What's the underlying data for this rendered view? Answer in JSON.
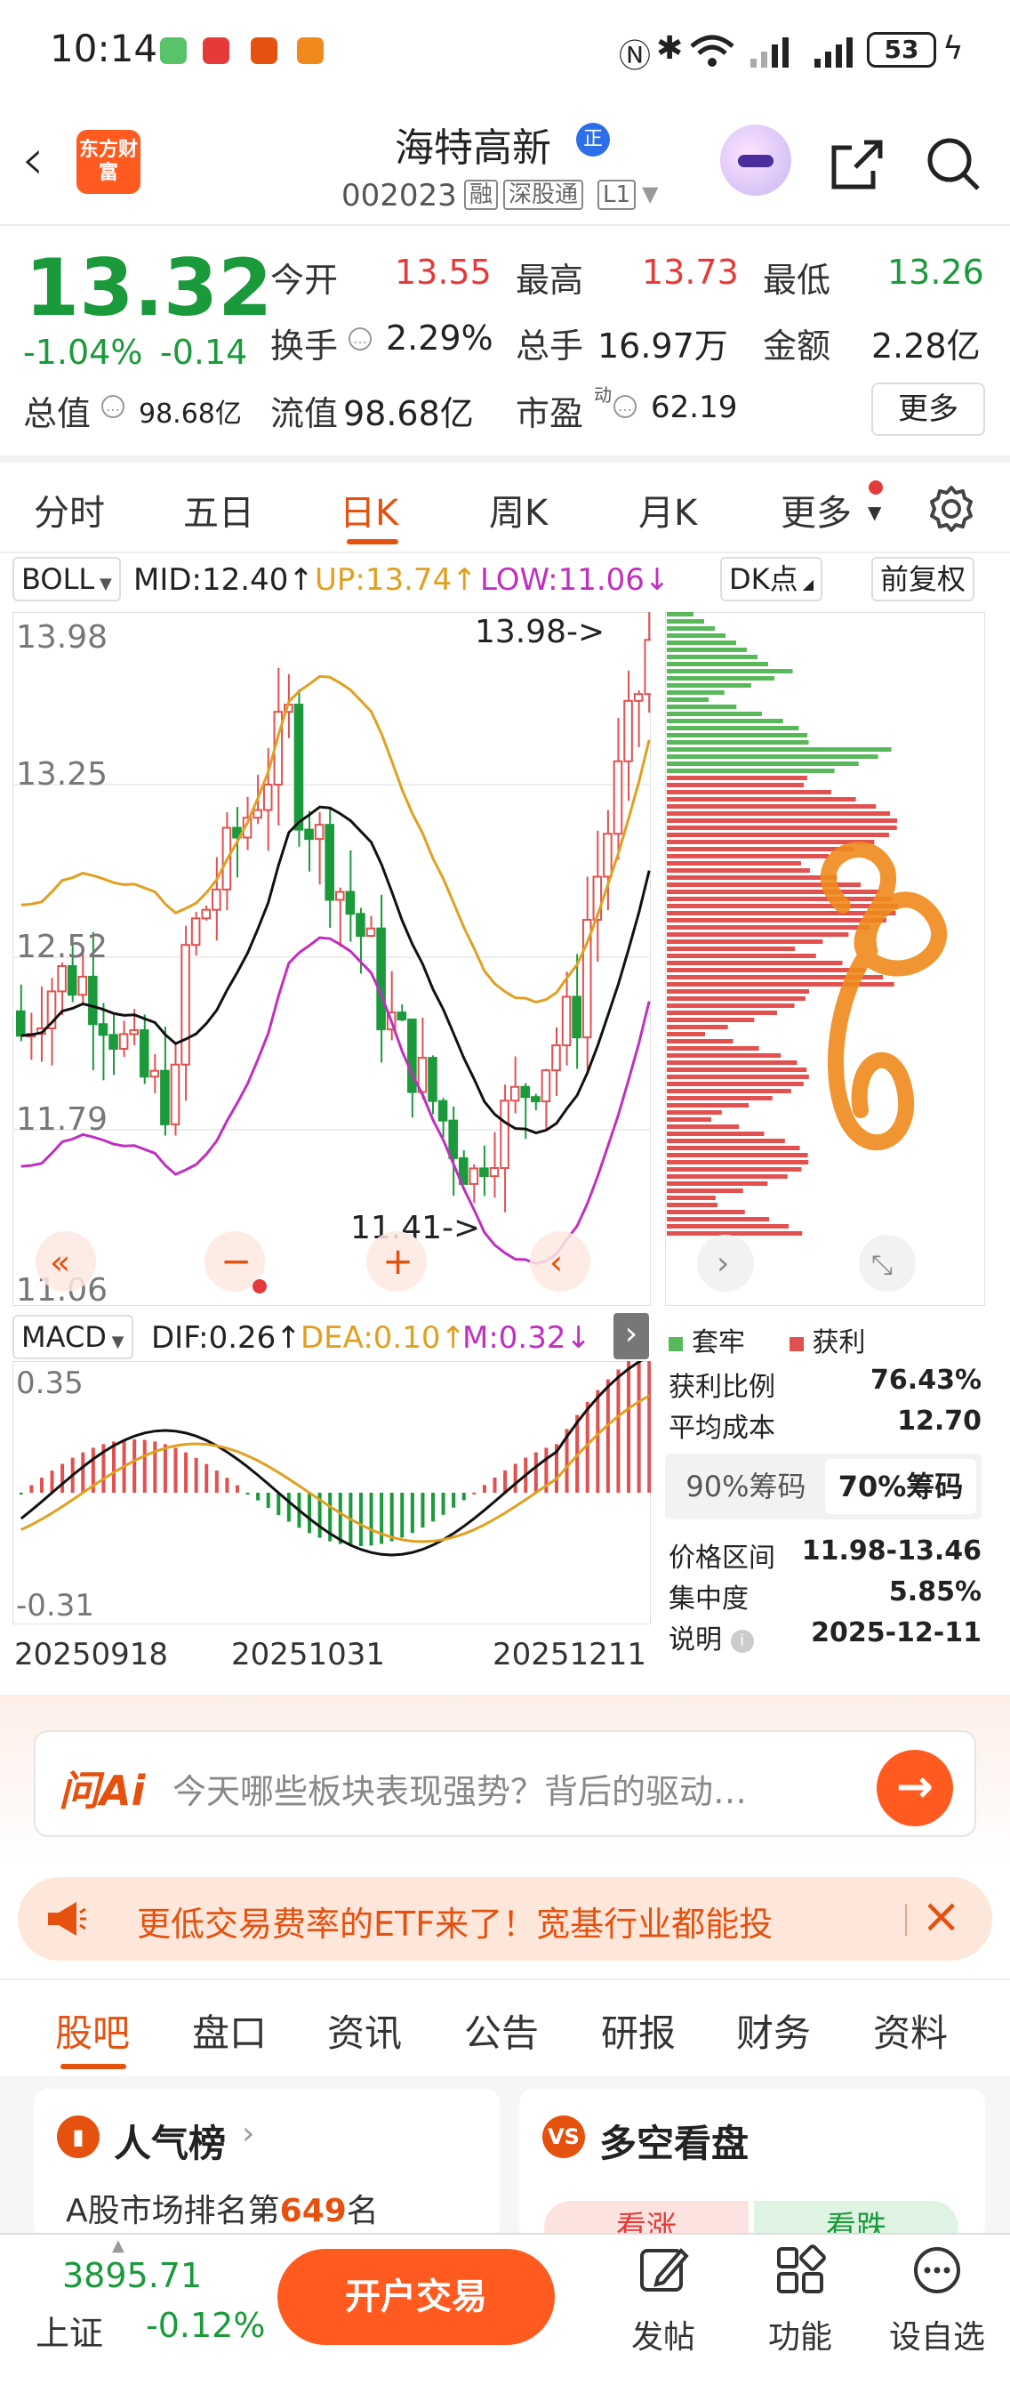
{
  "status_bar": {
    "time": "10:14",
    "battery": "53"
  },
  "header": {
    "app_logo": "东方财富",
    "stock_name": "海特高新",
    "name_badge": "正",
    "code": "002023",
    "tags": [
      "融",
      "深股通",
      "L1"
    ]
  },
  "quote": {
    "price": "13.32",
    "change_pct": "-1.04%",
    "change_abs": "-0.14",
    "open_label": "今开",
    "open": "13.55",
    "high_label": "最高",
    "high": "13.73",
    "low_label": "最低",
    "low": "13.26",
    "turnover_label": "换手",
    "turnover": "2.29%",
    "volume_label": "总手",
    "volume": "16.97万",
    "amount_label": "金额",
    "amount": "2.28亿",
    "total_mv_label": "总值",
    "total_mv": "98.68亿",
    "float_mv_label": "流值",
    "float_mv": "98.68亿",
    "pe_label": "市盈",
    "pe_sup": "动",
    "pe": "62.19",
    "more_button": "更多"
  },
  "period_tabs": [
    "分时",
    "五日",
    "日K",
    "周K",
    "月K",
    "更多"
  ],
  "active_period": "日K",
  "indicator_bar": {
    "name": "BOLL",
    "mid": "MID:12.40↑",
    "up": "UP:13.74↑",
    "low": "LOW:11.06↓",
    "dk_button": "DK点",
    "adjust_button": "前复权"
  },
  "kchart": {
    "y_ticks": [
      "13.98",
      "13.25",
      "12.52",
      "11.79",
      "11.06"
    ],
    "max_annotation": "13.98->",
    "min_annotation": "11.41->"
  },
  "macd_bar": {
    "name": "MACD",
    "dif": "DIF:0.26↑",
    "dea": "DEA:0.10↑",
    "m": "M:0.32↓"
  },
  "macd": {
    "y_ticks": [
      "0.35",
      "-0.31"
    ]
  },
  "x_labels": [
    "20250918",
    "20251031",
    "20251211"
  ],
  "chip_info": {
    "legend_trapped": "套牢",
    "legend_profit": "获利",
    "profit_ratio_label": "获利比例",
    "profit_ratio": "76.43%",
    "avg_cost_label": "平均成本",
    "avg_cost": "12.70",
    "seg_90": "90%筹码",
    "seg_70": "70%筹码",
    "range_label": "价格区间",
    "range": "11.98-13.46",
    "concentration_label": "集中度",
    "concentration": "5.85%",
    "note_label": "说明",
    "note_date": "2025-12-11"
  },
  "ai": {
    "logo": "问Ai",
    "placeholder": "今天哪些板块表现强势？背后的驱动…"
  },
  "banner": {
    "text": "更低交易费率的ETF来了！宽基行业都能投"
  },
  "sub_tabs": [
    "股吧",
    "盘口",
    "资讯",
    "公告",
    "研报",
    "财务",
    "资料"
  ],
  "cards": {
    "popularity_title": "人气榜",
    "popularity_sub_prefix": "A股市场排名第",
    "popularity_rank": "649",
    "popularity_sub_suffix": "名",
    "bullbear_title": "多空看盘",
    "bull_label": "看涨",
    "bear_label": "看跌"
  },
  "bottom_bar": {
    "index_value": "3895.71",
    "index_name": "上证",
    "index_change": "-0.12%",
    "trade_button": "开户交易",
    "post": "发帖",
    "functions": "功能",
    "watchlist": "设自选"
  },
  "colors": {
    "accent": "#e5510f",
    "up": "#e43a3a",
    "down": "#1a9a3a",
    "boll_up": "#e0a020",
    "boll_low": "#c030c0"
  }
}
